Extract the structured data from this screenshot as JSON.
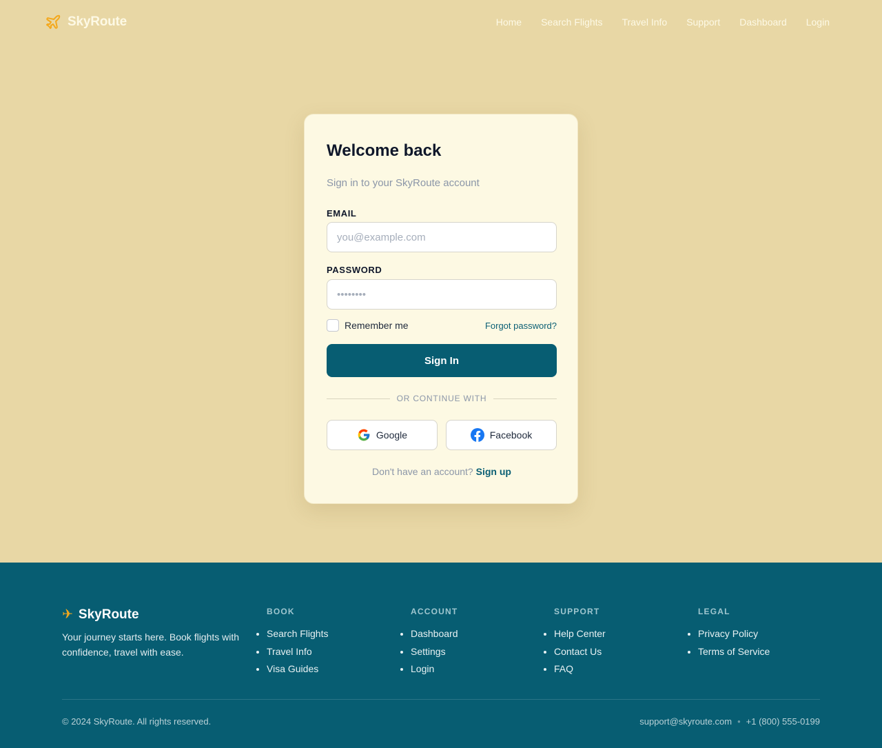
{
  "header": {
    "brand": "SkyRoute",
    "nav": [
      {
        "label": "Home"
      },
      {
        "label": "Search Flights"
      },
      {
        "label": "Travel Info"
      },
      {
        "label": "Support"
      },
      {
        "label": "Dashboard"
      },
      {
        "label": "Login"
      }
    ]
  },
  "login": {
    "title": "Welcome back",
    "subtitle": "Sign in to your SkyRoute account",
    "email_label": "EMAIL",
    "email_placeholder": "you@example.com",
    "password_label": "PASSWORD",
    "password_placeholder": "••••••••",
    "remember_label": "Remember me",
    "forgot_label": "Forgot password?",
    "submit_label": "Sign In",
    "divider_text": "OR CONTINUE WITH",
    "social": {
      "google_label": "Google",
      "facebook_label": "Facebook"
    },
    "signup_prompt": "Don't have an account?",
    "signup_link": "Sign up"
  },
  "footer": {
    "brand": "SkyRoute",
    "tagline": "Your journey starts here. Book flights with confidence, travel with ease.",
    "columns": [
      {
        "heading": "BOOK",
        "links": [
          "Search Flights",
          "Travel Info",
          "Visa Guides"
        ]
      },
      {
        "heading": "ACCOUNT",
        "links": [
          "Dashboard",
          "Settings",
          "Login"
        ]
      },
      {
        "heading": "SUPPORT",
        "links": [
          "Help Center",
          "Contact Us",
          "FAQ"
        ]
      },
      {
        "heading": "LEGAL",
        "links": [
          "Privacy Policy",
          "Terms of Service"
        ]
      }
    ],
    "copyright": "© 2024 SkyRoute. All rights reserved.",
    "email": "support@skyroute.com",
    "phone": "+1 (800) 555-0199"
  },
  "icons": {
    "brand": "airplane-icon",
    "footer_brand": "airplane-icon",
    "google": "google-icon",
    "facebook": "facebook-icon"
  },
  "colors": {
    "page_background": "#e8d7a5",
    "card_background": "#fdf9e3",
    "primary": "#075d72",
    "accent": "#f4a81c",
    "footer_background": "#075d72"
  }
}
